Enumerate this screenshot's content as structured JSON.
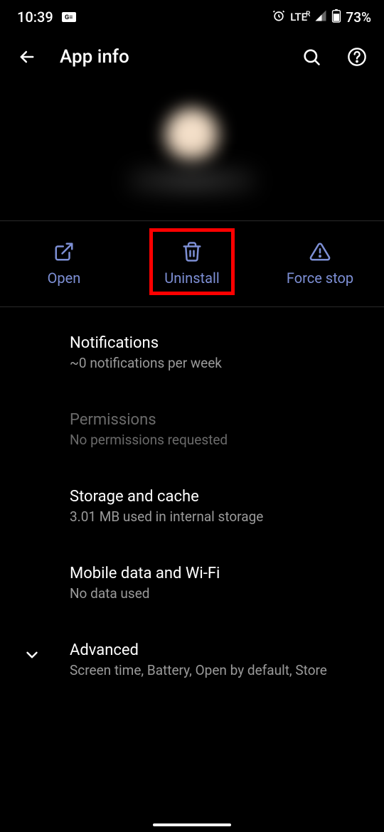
{
  "status": {
    "time": "10:39",
    "lte": "LTE",
    "roaming": "R",
    "battery": "73%"
  },
  "header": {
    "title": "App info"
  },
  "actions": {
    "open": "Open",
    "uninstall": "Uninstall",
    "forcestop": "Force stop"
  },
  "settings": {
    "notifications": {
      "title": "Notifications",
      "sub": "~0 notifications per week"
    },
    "permissions": {
      "title": "Permissions",
      "sub": "No permissions requested"
    },
    "storage": {
      "title": "Storage and cache",
      "sub": "3.01 MB used in internal storage"
    },
    "mobile": {
      "title": "Mobile data and Wi-Fi",
      "sub": "No data used"
    },
    "advanced": {
      "title": "Advanced",
      "sub": "Screen time, Battery, Open by default, Store"
    }
  },
  "colors": {
    "accent": "#7d8fd5",
    "highlight": "#ff0000"
  }
}
